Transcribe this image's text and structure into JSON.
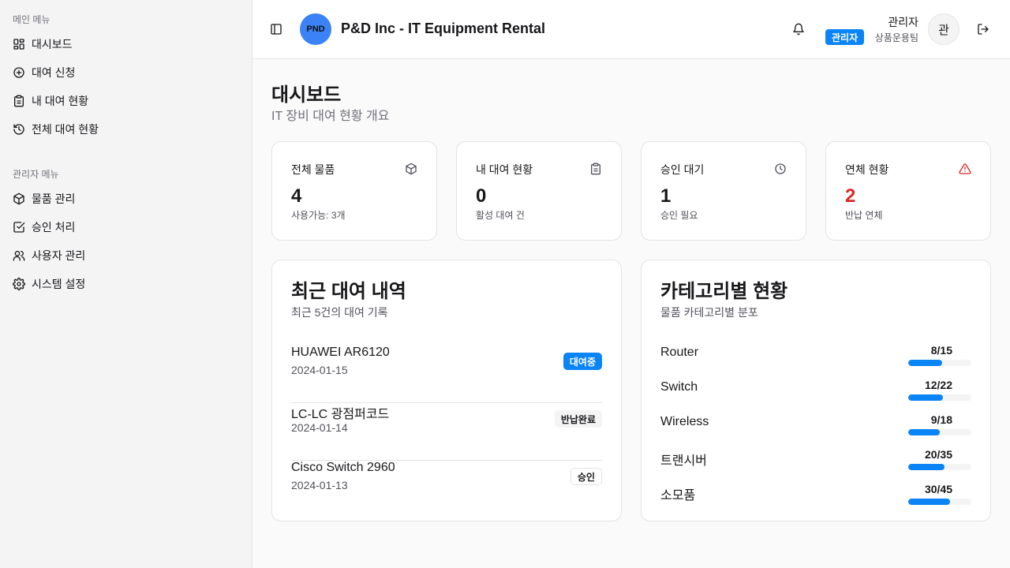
{
  "sidebar": {
    "main_title": "메인 메뉴",
    "main_items": [
      {
        "label": "대시보드",
        "icon": "dashboard-icon"
      },
      {
        "label": "대여 신청",
        "icon": "plus-circle-icon"
      },
      {
        "label": "내 대여 현황",
        "icon": "clipboard-icon"
      },
      {
        "label": "전체 대여 현황",
        "icon": "history-icon"
      }
    ],
    "admin_title": "관리자 메뉴",
    "admin_items": [
      {
        "label": "물품 관리",
        "icon": "package-icon"
      },
      {
        "label": "승인 처리",
        "icon": "check-square-icon"
      },
      {
        "label": "사용자 관리",
        "icon": "users-icon"
      },
      {
        "label": "시스템 설정",
        "icon": "gear-icon"
      }
    ]
  },
  "header": {
    "logo_text": "PND",
    "title": "P&D Inc - IT Equipment Rental",
    "user_name": "관리자",
    "role_badge": "관리자",
    "team": "상품운용팀",
    "avatar_text": "관"
  },
  "page": {
    "title": "대시보드",
    "subtitle": "IT 장비 대여 현황 개요"
  },
  "stats": [
    {
      "label": "전체 물품",
      "value": "4",
      "desc": "사용가능: 3개",
      "icon": "package-icon"
    },
    {
      "label": "내 대여 현황",
      "value": "0",
      "desc": "활성 대여 건",
      "icon": "clipboard-icon"
    },
    {
      "label": "승인 대기",
      "value": "1",
      "desc": "승인 필요",
      "icon": "clock-icon"
    },
    {
      "label": "연체 현황",
      "value": "2",
      "desc": "반납 연체",
      "icon": "alert-triangle-icon",
      "color": "#dc2626"
    }
  ],
  "recent": {
    "title": "최근 대여 내역",
    "subtitle": "최근 5건의 대여 기록",
    "items": [
      {
        "name": "HUAWEI AR6120",
        "date": "2024-01-15",
        "status": "대여중"
      },
      {
        "name": "LC-LC 광점퍼코드",
        "date": "2024-01-14",
        "status": "반납완료"
      },
      {
        "name": "Cisco Switch 2960",
        "date": "2024-01-13",
        "status": "승인"
      }
    ]
  },
  "categories": {
    "title": "카테고리별 현황",
    "subtitle": "물품 카테고리별 분포",
    "items": [
      {
        "name": "Router",
        "count": "8/15",
        "ratio": 0.5333
      },
      {
        "name": "Switch",
        "count": "12/22",
        "ratio": 0.5455
      },
      {
        "name": "Wireless",
        "count": "9/18",
        "ratio": 0.5
      },
      {
        "name": "트랜시버",
        "count": "20/35",
        "ratio": 0.5714
      },
      {
        "name": "소모품",
        "count": "30/45",
        "ratio": 0.6667
      }
    ]
  },
  "colors": {
    "accent": "#0b84f5",
    "danger": "#dc2626",
    "logo": "#3b82f6"
  }
}
